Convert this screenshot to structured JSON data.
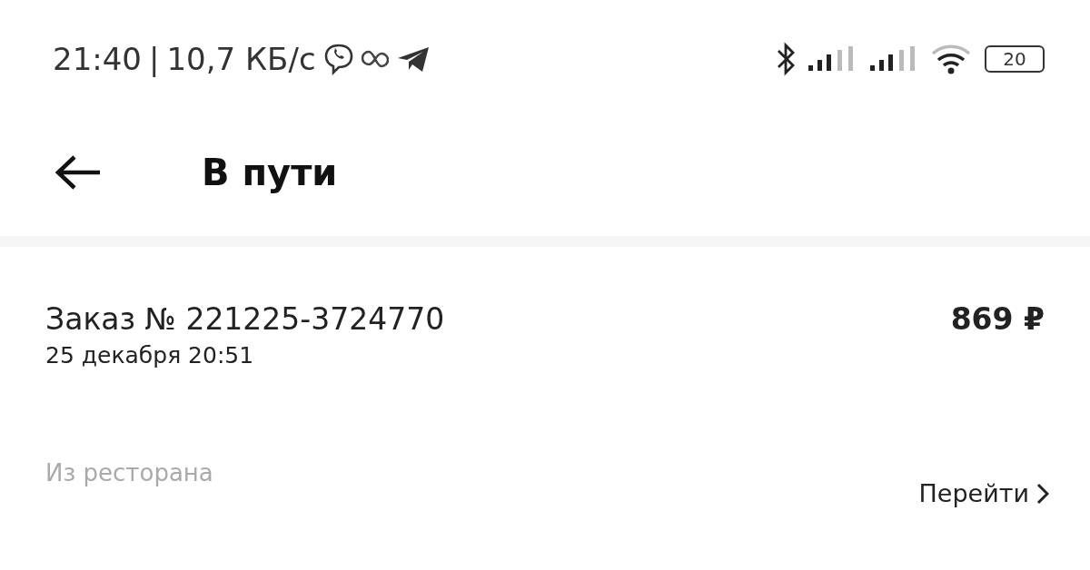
{
  "status_bar": {
    "time": "21:40",
    "separator": "|",
    "speed": "10,7 КБ/с",
    "battery": "20"
  },
  "header": {
    "title": "В пути"
  },
  "order": {
    "number": "Заказ № 221225-3724770",
    "date": "25 декабря 20:51",
    "price": "869 ₽"
  },
  "restaurant": {
    "label": "Из ресторана",
    "link": "Перейти"
  }
}
